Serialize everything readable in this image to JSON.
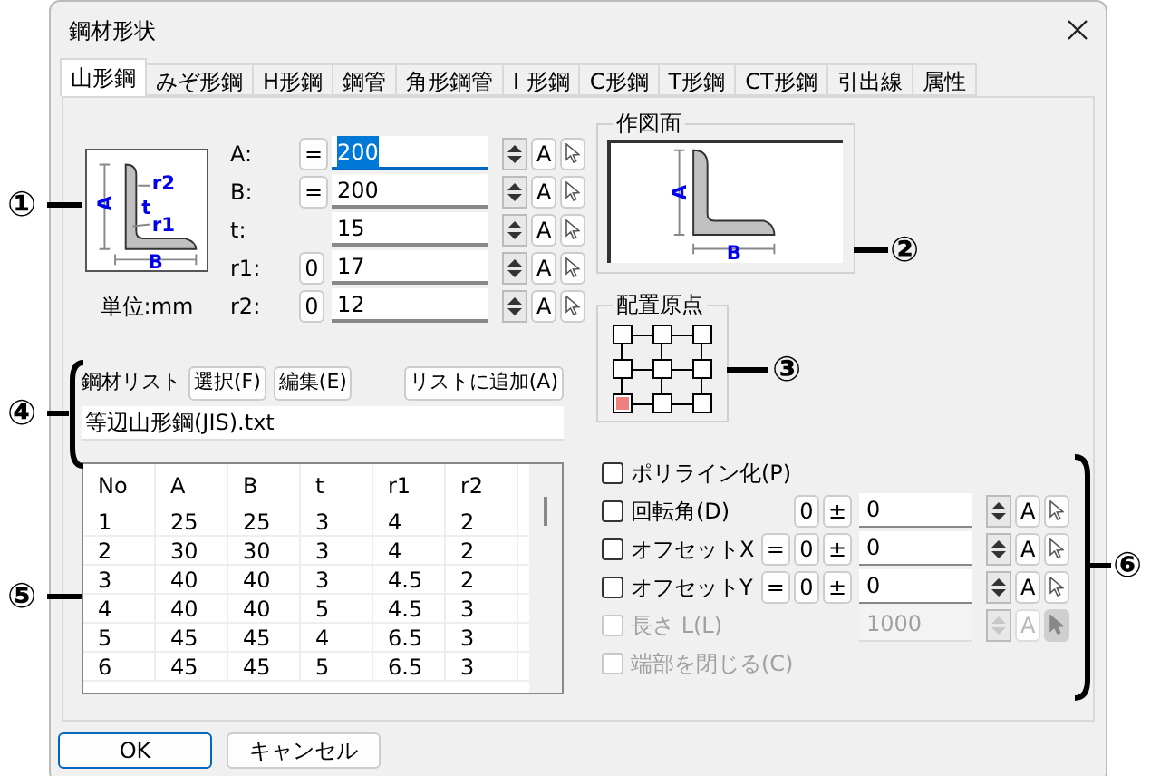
{
  "window": {
    "title": "鋼材形状"
  },
  "tabs": [
    {
      "label": "山形鋼",
      "selected": true
    },
    {
      "label": "みぞ形鋼",
      "selected": false
    },
    {
      "label": "H形鋼",
      "selected": false
    },
    {
      "label": "鋼管",
      "selected": false
    },
    {
      "label": "角形鋼管",
      "selected": false
    },
    {
      "label": "I 形鋼",
      "selected": false
    },
    {
      "label": "C形鋼",
      "selected": false
    },
    {
      "label": "T形鋼",
      "selected": false
    },
    {
      "label": "CT形鋼",
      "selected": false
    },
    {
      "label": "引出線",
      "selected": false
    },
    {
      "label": "属性",
      "selected": false
    }
  ],
  "section_figure": {
    "labels": [
      "A",
      "t",
      "r2",
      "r1",
      "B"
    ],
    "unit": "単位:mm"
  },
  "params": [
    {
      "label": "A:",
      "prefix": "=",
      "value": "200",
      "focused": true,
      "auto_label": "A"
    },
    {
      "label": "B:",
      "prefix": "=",
      "value": "200",
      "focused": false,
      "auto_label": "A"
    },
    {
      "label": "t:",
      "value": "15",
      "focused": false,
      "auto_label": "A"
    },
    {
      "label": "r1:",
      "prefix": "0",
      "value": "17",
      "focused": false,
      "auto_label": "A"
    },
    {
      "label": "r2:",
      "prefix": "0",
      "value": "12",
      "focused": false,
      "auto_label": "A"
    }
  ],
  "drawing_view": {
    "title": "作図面",
    "labels": [
      "A",
      "B"
    ]
  },
  "origin": {
    "title": "配置原点",
    "points": [
      {
        "selected": false
      },
      {
        "selected": false
      },
      {
        "selected": false
      },
      {
        "selected": false
      },
      {
        "selected": false
      },
      {
        "selected": false
      },
      {
        "selected": true
      },
      {
        "selected": false
      },
      {
        "selected": false
      }
    ]
  },
  "steel_list": {
    "label": "鋼材リスト",
    "buttons": [
      "選択(F)",
      "編集(E)",
      "リストに追加(A)"
    ],
    "file": "等辺山形鋼(JIS).txt"
  },
  "table": {
    "columns": [
      "No",
      "A",
      "B",
      "t",
      "r1",
      "r2"
    ],
    "rows": [
      [
        "1",
        "25",
        "25",
        "3",
        "4",
        "2"
      ],
      [
        "2",
        "30",
        "30",
        "3",
        "4",
        "2"
      ],
      [
        "3",
        "40",
        "40",
        "3",
        "4.5",
        "2"
      ],
      [
        "4",
        "40",
        "40",
        "5",
        "4.5",
        "3"
      ],
      [
        "5",
        "45",
        "45",
        "4",
        "6.5",
        "3"
      ],
      [
        "6",
        "45",
        "45",
        "5",
        "6.5",
        "3"
      ]
    ]
  },
  "options": [
    {
      "kind": "check",
      "label": "ポリライン化(P)",
      "checked": false,
      "disabled": false
    },
    {
      "kind": "param",
      "label": "回転角(D)",
      "checked": false,
      "disabled": false,
      "prefixes": [
        "0",
        "±"
      ],
      "value": "0",
      "auto_label": "A"
    },
    {
      "kind": "param",
      "label": "オフセットX",
      "checked": false,
      "disabled": false,
      "prefixes": [
        "=",
        "0",
        "±"
      ],
      "value": "0",
      "auto_label": "A"
    },
    {
      "kind": "param",
      "label": "オフセットY",
      "checked": false,
      "disabled": false,
      "prefixes": [
        "=",
        "0",
        "±"
      ],
      "value": "0",
      "auto_label": "A"
    },
    {
      "kind": "param",
      "label": "長さ L(L)",
      "checked": false,
      "disabled": true,
      "value": "1000",
      "auto_label": "A"
    },
    {
      "kind": "check",
      "label": "端部を閉じる(C)",
      "checked": false,
      "disabled": true
    }
  ],
  "buttons": [
    {
      "label": "OK",
      "default": true
    },
    {
      "label": "キャンセル",
      "default": false
    }
  ],
  "callouts": [
    "①",
    "②",
    "③",
    "④",
    "⑤",
    "⑥"
  ]
}
